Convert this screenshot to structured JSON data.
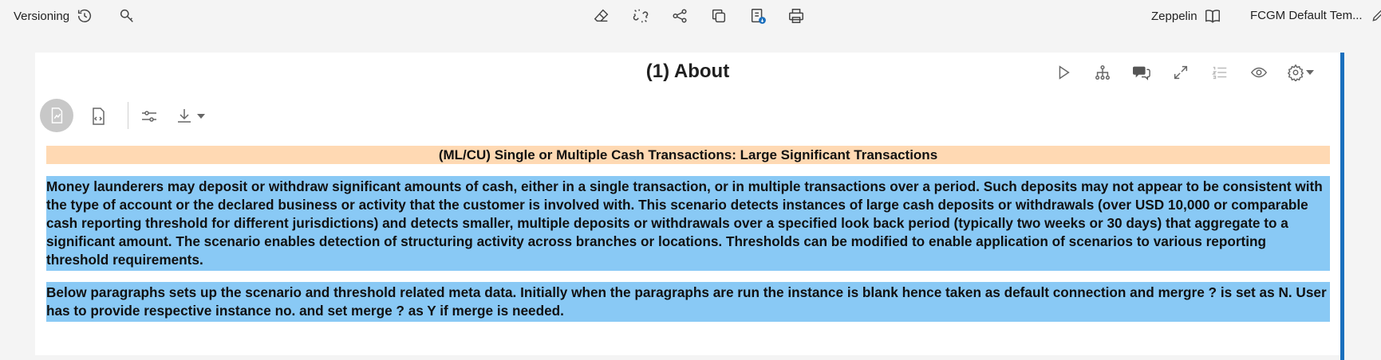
{
  "toolbar": {
    "versioning_label": "Versioning",
    "interpreter_label": "Zeppelin",
    "template_label": "FCGM Default Tem..."
  },
  "icons": {
    "versioning": "history-icon",
    "search": "search-key-icon",
    "clear": "eraser-icon",
    "unlink": "unlink-icon",
    "share": "share-icon",
    "clone": "clone-icon",
    "export": "export-notebook-icon",
    "print": "print-icon",
    "book": "book-icon",
    "edit": "pencil-icon"
  },
  "paragraph": {
    "title": "(1) About",
    "scenario_title": "(ML/CU) Single or Multiple Cash Transactions: Large Significant Transactions",
    "description_1": "Money launderers may deposit or withdraw significant amounts of cash, either in a single transaction, or in multiple transactions over a period. Such deposits may not appear to be consistent with the type of account or the declared business or activity that the customer is involved with. This scenario detects instances of large cash deposits or withdrawals (over USD 10,000 or comparable cash reporting threshold for different jurisdictions) and detects smaller, multiple deposits or withdrawals over a specified look back period (typically two weeks or 30 days) that aggregate to a significant amount. The scenario enables detection of structuring activity across branches or locations. Thresholds can be modified to enable application of scenarios to various reporting threshold requirements.",
    "description_2": "Below paragraphs sets up the scenario and threshold related meta data. Initially when the paragraphs are run the instance is blank hence taken as default connection and mergre ? is set as N. User has to provide respective instance no. and set merge ? as Y if merge is needed."
  },
  "colors": {
    "accent": "#1a6fbd",
    "title_band": "#ffd9b3",
    "highlight": "#89c9f5"
  }
}
